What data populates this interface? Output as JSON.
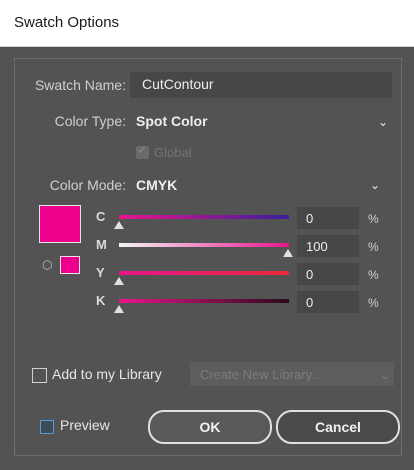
{
  "dialog": {
    "title": "Swatch Options",
    "swatch_name_label": "Swatch Name:",
    "swatch_name_value": "CutContour",
    "color_type_label": "Color Type:",
    "color_type_value": "Spot Color",
    "global_label": "Global",
    "global_checked": true,
    "color_mode_label": "Color Mode:",
    "color_mode_value": "CMYK",
    "swatch_color": "#ec008c",
    "channels": [
      {
        "label": "C",
        "value": "0",
        "unit": "%",
        "level": 0.0
      },
      {
        "label": "M",
        "value": "100",
        "unit": "%",
        "level": 1.0
      },
      {
        "label": "Y",
        "value": "0",
        "unit": "%",
        "level": 0.0
      },
      {
        "label": "K",
        "value": "0",
        "unit": "%",
        "level": 0.0
      }
    ],
    "add_to_library_label": "Add to my Library",
    "add_to_library_checked": false,
    "library_dropdown_value": "Create New Library...",
    "preview_label": "Preview",
    "preview_checked": false,
    "ok_label": "OK",
    "cancel_label": "Cancel"
  },
  "icons": {
    "dropdown": "chevron-down-icon",
    "gamut": "out-of-gamut-cube-icon",
    "checkmark": "checkmark-icon"
  }
}
